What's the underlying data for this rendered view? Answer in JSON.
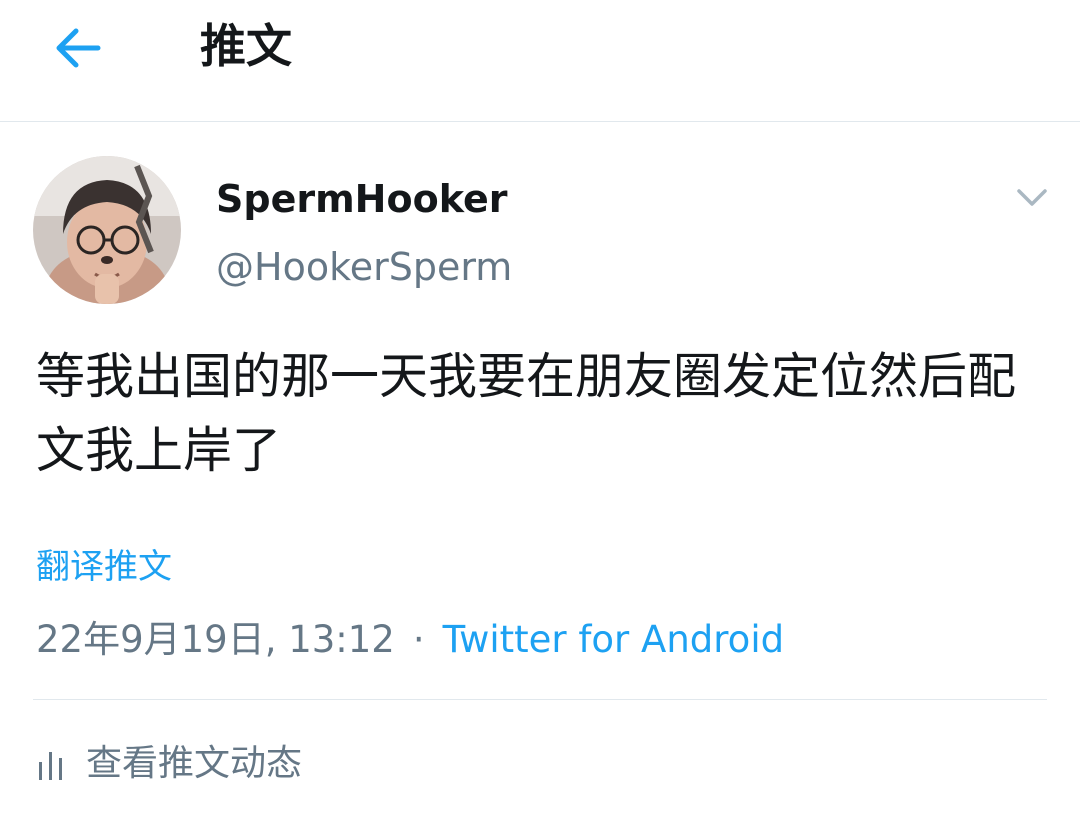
{
  "header": {
    "back_icon": "arrow-left-icon",
    "title": "推文"
  },
  "tweet": {
    "display_name": "SpermHooker",
    "handle": "@HookerSperm",
    "more_icon": "chevron-down-icon",
    "text": "等我出国的那一天我要在朋友圈发定位然后配文我上岸了",
    "translate_label": "翻译推文",
    "timestamp": "22年9月19日, 13:12",
    "separator": "·",
    "source": "Twitter for Android"
  },
  "activity": {
    "icon": "bar-chart-icon",
    "label": "查看推文动态"
  },
  "colors": {
    "accent": "#1da1f2",
    "secondary_text": "#657786",
    "primary_text": "#14171a",
    "divider": "#e1e8ed"
  }
}
